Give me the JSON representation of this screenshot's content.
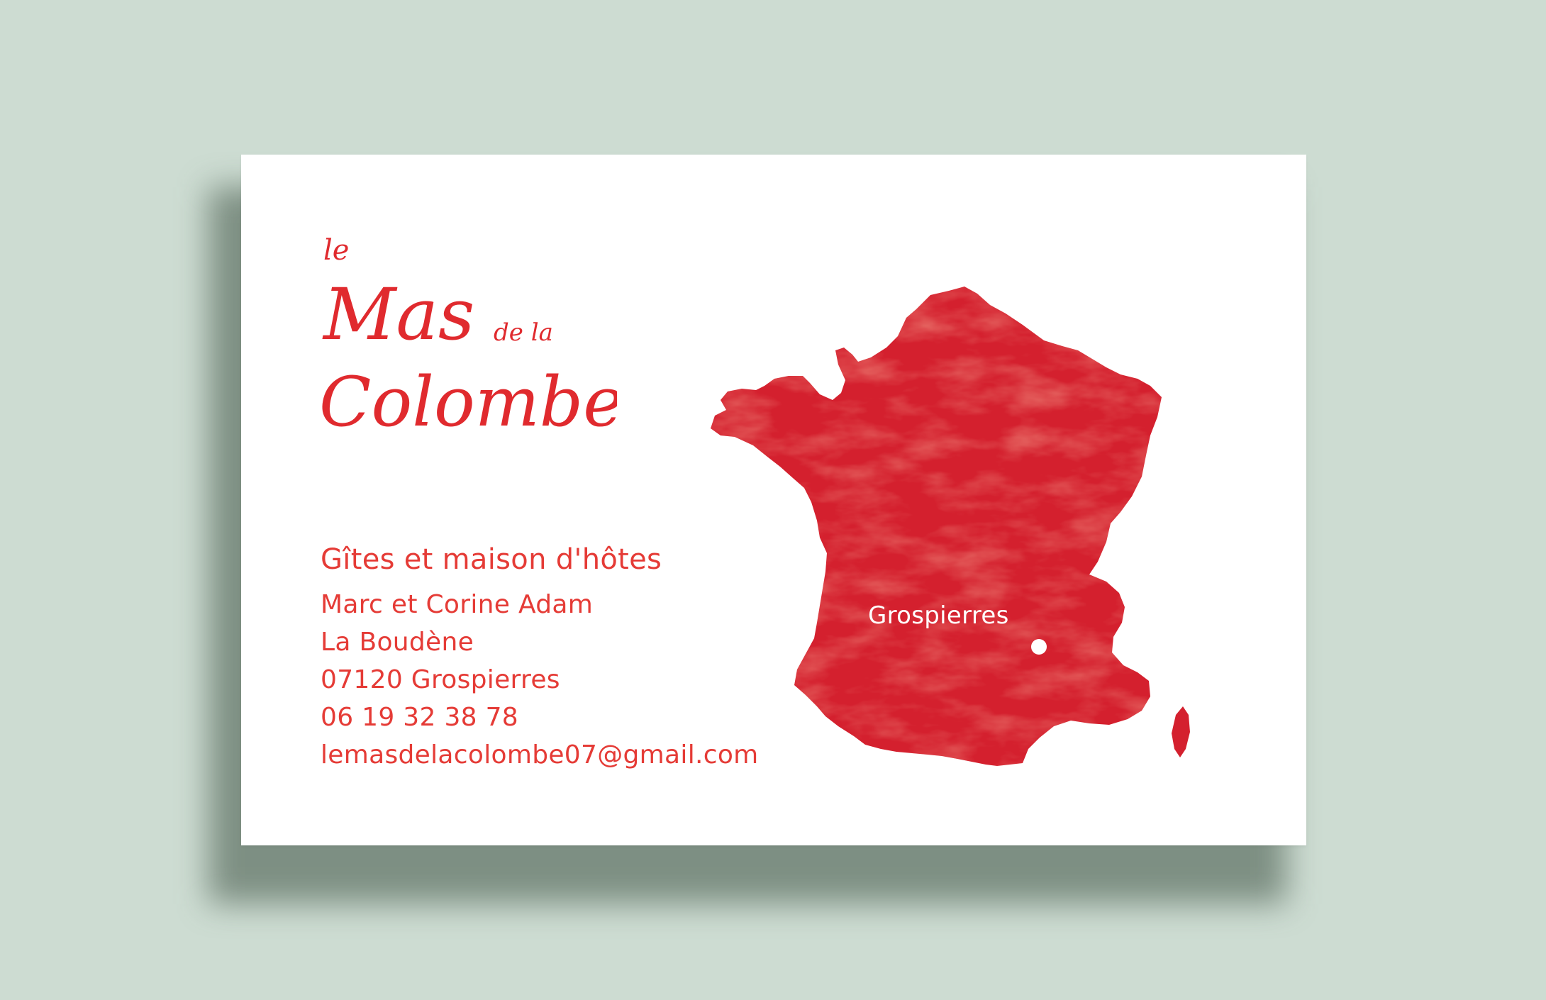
{
  "logo": {
    "word_le": "le",
    "word_mas": "Mas",
    "word_dela": "de la",
    "word_colombe": "Colombe"
  },
  "card": {
    "tagline": "Gîtes et maison d'hôtes",
    "names": "Marc et Corine Adam",
    "address_line1": "La Boudène",
    "address_line2": "07120 Grospierres",
    "phone": "06 19 32 38 78",
    "email": "lemasdelacolombe07@gmail.com"
  },
  "map": {
    "place_label": "Grospierres"
  },
  "colors": {
    "background": "#cddcd2",
    "card": "#ffffff",
    "accent_red": "#e53b36",
    "map_red": "#d4202e"
  }
}
